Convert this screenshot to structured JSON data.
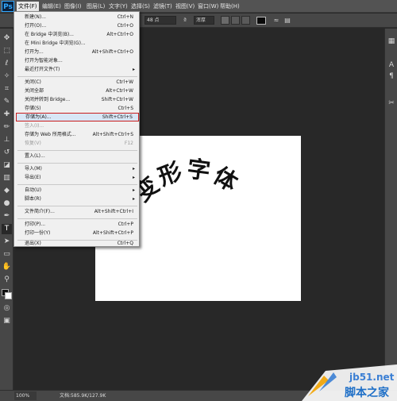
{
  "app": {
    "logo": "Ps",
    "colors": {
      "highlight_border": "#c91d1d",
      "canvas_bg": "#ffffff"
    }
  },
  "menubar": {
    "items": [
      "文件(F)",
      "编辑(E)",
      "图像(I)",
      "图层(L)",
      "文字(Y)",
      "选择(S)",
      "滤镜(T)",
      "视图(V)",
      "窗口(W)",
      "帮助(H)"
    ]
  },
  "options": {
    "font_size": "48 点",
    "aa_mode": "浑厚"
  },
  "file_menu": {
    "items": [
      {
        "label": "新建(N)...",
        "shortcut": "Ctrl+N"
      },
      {
        "label": "打开(O)...",
        "shortcut": "Ctrl+O"
      },
      {
        "label": "在 Bridge 中浏览(B)...",
        "shortcut": "Alt+Ctrl+O"
      },
      {
        "label": "在 Mini Bridge 中浏览(G)...",
        "shortcut": ""
      },
      {
        "label": "打开为...",
        "shortcut": "Alt+Shift+Ctrl+O"
      },
      {
        "label": "打开为智能对象...",
        "shortcut": ""
      },
      {
        "label": "最近打开文件(T)",
        "shortcut": ""
      },
      {
        "label": "关闭(C)",
        "shortcut": "Ctrl+W"
      },
      {
        "label": "关闭全部",
        "shortcut": "Alt+Ctrl+W"
      },
      {
        "label": "关闭并转到 Bridge...",
        "shortcut": "Shift+Ctrl+W"
      },
      {
        "label": "存储(S)",
        "shortcut": "Ctrl+S"
      },
      {
        "label": "存储为(A)...",
        "shortcut": "Shift+Ctrl+S"
      },
      {
        "label": "签入(I)...",
        "shortcut": ""
      },
      {
        "label": "存储为 Web 所用格式...",
        "shortcut": "Alt+Shift+Ctrl+S"
      },
      {
        "label": "恢复(V)",
        "shortcut": "F12"
      },
      {
        "label": "置入(L)...",
        "shortcut": ""
      },
      {
        "label": "导入(M)",
        "shortcut": ""
      },
      {
        "label": "导出(E)",
        "shortcut": ""
      },
      {
        "label": "自动(U)",
        "shortcut": ""
      },
      {
        "label": "脚本(R)",
        "shortcut": ""
      },
      {
        "label": "文件简介(F)...",
        "shortcut": "Alt+Shift+Ctrl+I"
      },
      {
        "label": "打印(P)...",
        "shortcut": "Ctrl+P"
      },
      {
        "label": "打印一份(Y)",
        "shortcut": "Alt+Shift+Ctrl+P"
      },
      {
        "label": "退出(X)",
        "shortcut": "Ctrl+Q"
      }
    ]
  },
  "canvas": {
    "warped_text": "变形字体"
  },
  "status": {
    "zoom": "100%",
    "doc_size": "文档:585.9K/127.9K"
  },
  "watermark": {
    "site": "jb51.net",
    "name": "脚本之家"
  }
}
